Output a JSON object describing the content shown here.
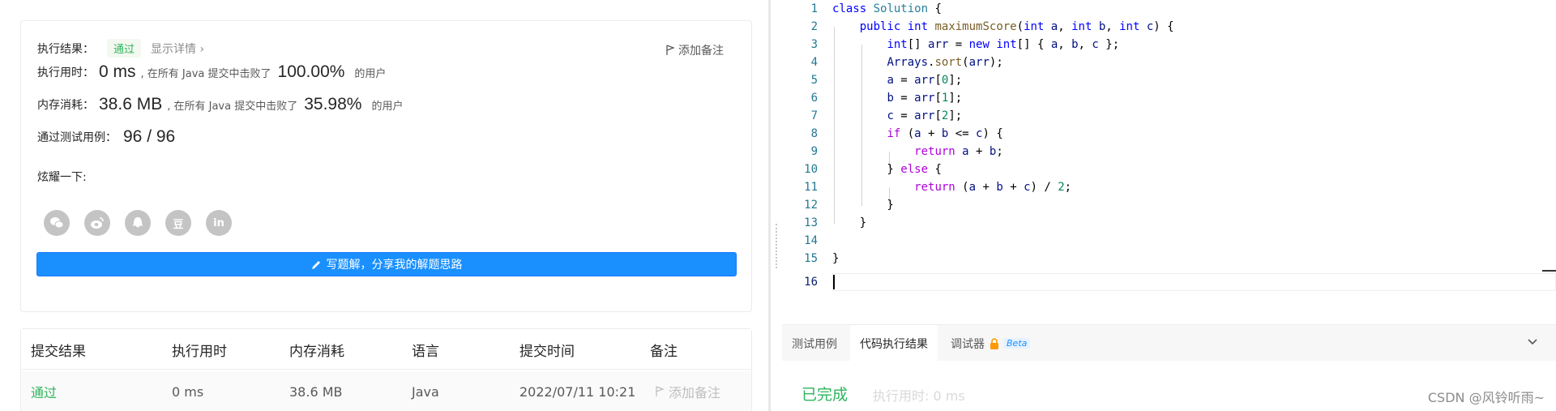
{
  "result": {
    "label": "执行结果：",
    "status": "通过",
    "show_detail": "显示详情 ›",
    "add_note": "添加备注",
    "runtime_label": "执行用时：",
    "runtime_value": "0 ms",
    "runtime_text": ", 在所有 Java 提交中击败了",
    "runtime_pct": "100.00%",
    "users1": "的用户",
    "memory_label": "内存消耗：",
    "memory_value": "38.6 MB",
    "memory_text": ", 在所有 Java 提交中击败了",
    "memory_pct": "35.98%",
    "users2": "的用户",
    "tests_label": "通过测试用例：",
    "tests_value": "96 / 96",
    "share_label": "炫耀一下:",
    "share_icons": [
      "wechat-icon",
      "weibo-icon",
      "qq-icon",
      "douban-icon",
      "linkedin-icon"
    ],
    "douban_glyph": "豆",
    "linkedin_glyph": "in",
    "write_button": "写题解，分享我的解题思路"
  },
  "submissions": {
    "headers": [
      "提交结果",
      "执行用时",
      "内存消耗",
      "语言",
      "提交时间",
      "备注"
    ],
    "rows": [
      {
        "result": "通过",
        "time": "0 ms",
        "memory": "38.6 MB",
        "language": "Java",
        "submitted": "2022/07/11 10:21",
        "note": "添加备注"
      }
    ]
  },
  "editor": {
    "line_numbers": [
      "1",
      "2",
      "3",
      "4",
      "5",
      "6",
      "7",
      "8",
      "9",
      "10",
      "11",
      "12",
      "13",
      "14",
      "15",
      "16"
    ]
  },
  "console": {
    "tabs": [
      "测试用例",
      "代码执行结果",
      "调试器"
    ],
    "beta": "Beta",
    "status": "已完成",
    "exec_time": "执行用时: 0 ms",
    "collapse_glyph": "⌄"
  },
  "watermark": "CSDN @风铃听雨~",
  "colors": {
    "accent": "#1a90ff",
    "success": "#2db55d"
  }
}
